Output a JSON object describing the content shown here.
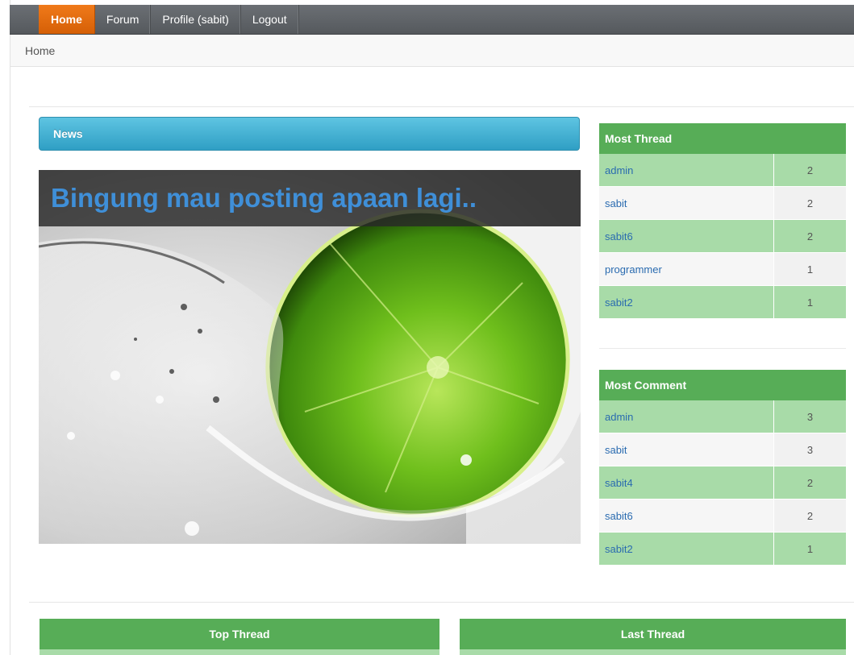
{
  "nav": {
    "items": [
      {
        "label": "Home",
        "active": true
      },
      {
        "label": "Forum",
        "active": false
      },
      {
        "label": "Profile (sabit)",
        "active": false
      },
      {
        "label": "Logout",
        "active": false
      }
    ]
  },
  "breadcrumb": {
    "current": "Home"
  },
  "news": {
    "header": "News",
    "caption": "Bingung mau posting apaan lagi.."
  },
  "most_thread": {
    "title": "Most Thread",
    "rows": [
      {
        "name": "admin",
        "count": "2"
      },
      {
        "name": "sabit",
        "count": "2"
      },
      {
        "name": "sabit6",
        "count": "2"
      },
      {
        "name": "programmer",
        "count": "1"
      },
      {
        "name": "sabit2",
        "count": "1"
      }
    ]
  },
  "most_comment": {
    "title": "Most Comment",
    "rows": [
      {
        "name": "admin",
        "count": "3"
      },
      {
        "name": "sabit",
        "count": "3"
      },
      {
        "name": "sabit4",
        "count": "2"
      },
      {
        "name": "sabit6",
        "count": "2"
      },
      {
        "name": "sabit2",
        "count": "1"
      }
    ]
  },
  "bottom": {
    "top_thread_title": "Top Thread",
    "last_thread_title": "Last Thread"
  },
  "colors": {
    "nav_active": "#e5700f",
    "table_header": "#57ad57",
    "row_alt": "#a8dba8",
    "news_header": "#3fb0d4",
    "caption_text": "#3f8fd8"
  }
}
